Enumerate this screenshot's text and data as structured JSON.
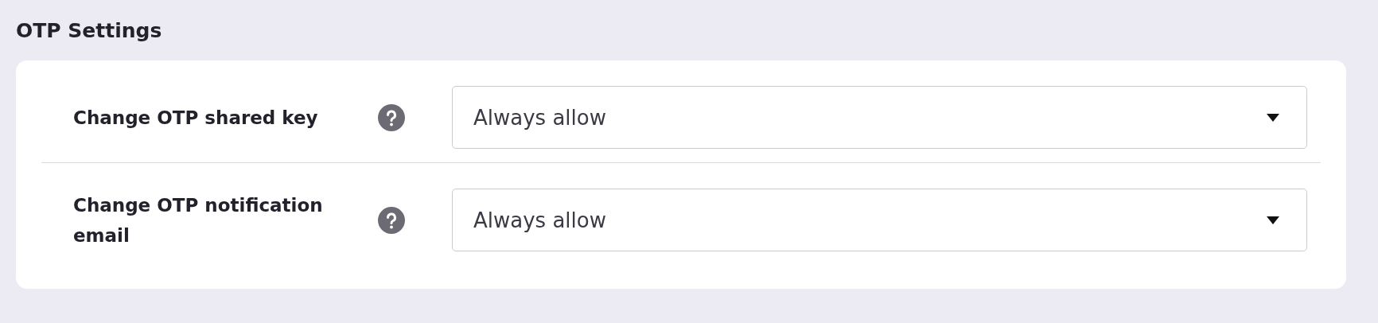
{
  "section_title": "OTP Settings",
  "settings": [
    {
      "label": "Change OTP shared key",
      "value": "Always allow"
    },
    {
      "label": "Change OTP notification email",
      "value": "Always allow"
    }
  ]
}
